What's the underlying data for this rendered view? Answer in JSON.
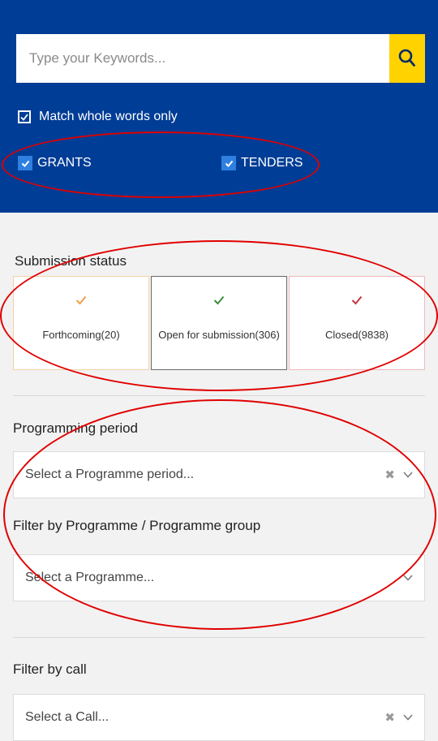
{
  "search": {
    "placeholder": "Type your Keywords...",
    "match_whole_words_label": "Match whole words only",
    "match_whole_words_checked": true
  },
  "types": [
    {
      "label": "GRANTS",
      "checked": true
    },
    {
      "label": "TENDERS",
      "checked": true
    }
  ],
  "submission_status": {
    "title": "Submission status",
    "cards": [
      {
        "label": "Forthcoming(20)",
        "color": "#f0a046"
      },
      {
        "label": "Open for submission(306)",
        "color": "#3c8f3c"
      },
      {
        "label": "Closed(9838)",
        "color": "#c8343f"
      }
    ]
  },
  "programming_period": {
    "title": "Programming period",
    "placeholder": "Select a Programme period..."
  },
  "programme_filter": {
    "title": "Filter by Programme / Programme group",
    "placeholder": "Select a Programme..."
  },
  "call_filter": {
    "title": "Filter by call",
    "placeholder": "Select a Call..."
  },
  "colors": {
    "header_blue": "#003d96",
    "search_yellow": "#ffd200",
    "checkbox_blue": "#2f7fe0",
    "annotation_red": "#e00000"
  },
  "icons": [
    "search-icon",
    "checkmark-icon",
    "clear-icon",
    "chevron-down-icon"
  ]
}
